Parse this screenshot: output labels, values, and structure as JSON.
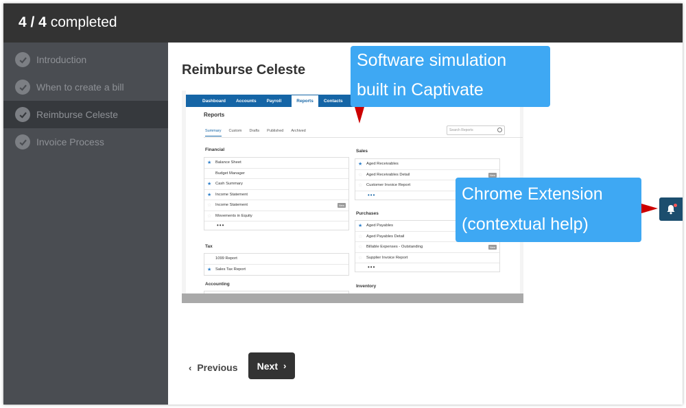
{
  "header": {
    "progress_count": "4 / 4",
    "progress_label": "completed"
  },
  "sidebar": {
    "items": [
      {
        "label": "Introduction"
      },
      {
        "label": "When to create a bill"
      },
      {
        "label": "Reimburse Celeste"
      },
      {
        "label": "Invoice Process"
      }
    ]
  },
  "lesson": {
    "title": "Reimburse Celeste"
  },
  "embedded_app": {
    "nav": [
      "Dashboard",
      "Accounts",
      "Payroll",
      "Reports",
      "Contacts"
    ],
    "reports_title": "Reports",
    "subtabs": [
      "Summary",
      "Custom",
      "Drafts",
      "Published",
      "Archived"
    ],
    "search_placeholder": "Search Reports",
    "new_badge": "New",
    "ellipsis": "•••",
    "financial": {
      "heading": "Financial",
      "rows": [
        "Balance Sheet",
        "Budget Manager",
        "Cash Summary",
        "Income Statement",
        "Income Statement",
        "Movements in Equity"
      ]
    },
    "tax": {
      "heading": "Tax",
      "rows": [
        "1099 Report",
        "Sales Tax Report"
      ]
    },
    "accounting": {
      "heading": "Accounting"
    },
    "sales": {
      "heading": "Sales",
      "rows": [
        "Aged Receivables",
        "Aged Receivables Detail",
        "Customer Invoice Report"
      ]
    },
    "purchases": {
      "heading": "Purchases",
      "rows": [
        "Aged Payables",
        "Aged Payables Detail",
        "Billable Expenses - Outstanding",
        "Supplier Invoice Report"
      ]
    },
    "inventory": {
      "heading": "Inventory"
    }
  },
  "callouts": {
    "captivate": {
      "line1": "Software simulation",
      "line2": "built in Captivate"
    },
    "extension": {
      "line1": "Chrome Extension",
      "line2": "(contextual help)"
    }
  },
  "footer": {
    "previous_label": "Previous",
    "next_label": "Next"
  },
  "colors": {
    "topbar": "#333333",
    "sidebar": "#4a4d52",
    "callout": "#3ea8f3",
    "arrow": "#cc0000",
    "app_nav": "#1565a6"
  },
  "icons": {
    "nav_item": "check-circle-icon",
    "help": "bell-icon",
    "prev": "chevron-left-icon",
    "next": "chevron-right-icon"
  }
}
